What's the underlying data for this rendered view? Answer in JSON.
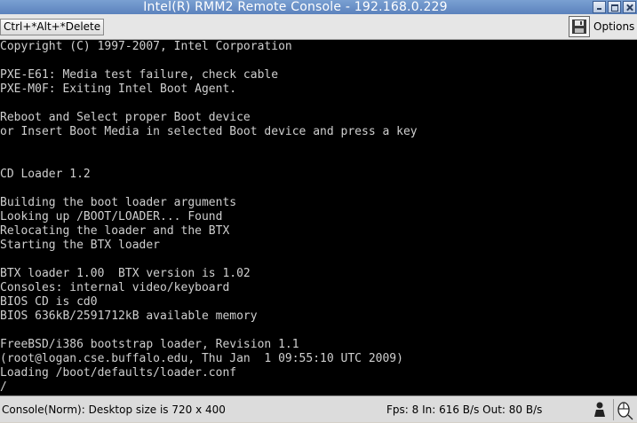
{
  "window": {
    "title": "Intel(R) RMM2 Remote Console - 192.168.0.229"
  },
  "toolbar": {
    "ctrl_alt_del_label": "Ctrl+*Alt+*Delete",
    "options_label": "Options",
    "save_icon": "floppy-disk-icon"
  },
  "console": {
    "lines": [
      "Copyright (C) 1997-2007, Intel Corporation",
      "",
      "PXE-E61: Media test failure, check cable",
      "PXE-M0F: Exiting Intel Boot Agent.",
      "",
      "Reboot and Select proper Boot device",
      "or Insert Boot Media in selected Boot device and press a key",
      "",
      "",
      "CD Loader 1.2",
      "",
      "Building the boot loader arguments",
      "Looking up /BOOT/LOADER... Found",
      "Relocating the loader and the BTX",
      "Starting the BTX loader",
      "",
      "BTX loader 1.00  BTX version is 1.02",
      "Consoles: internal video/keyboard",
      "BIOS CD is cd0",
      "BIOS 636kB/2591712kB available memory",
      "",
      "FreeBSD/i386 bootstrap loader, Revision 1.1",
      "(root@logan.cse.buffalo.edu, Thu Jan  1 09:55:10 UTC 2009)",
      "Loading /boot/defaults/loader.conf",
      "/"
    ],
    "background": "#000000",
    "foreground": "#cfcfcf"
  },
  "statusbar": {
    "left": "Console(Norm): Desktop size is 720 x 400",
    "right": "Fps: 8 In: 616 B/s Out: 80 B/s",
    "icons": [
      "user-icon",
      "mouse-icon"
    ]
  }
}
